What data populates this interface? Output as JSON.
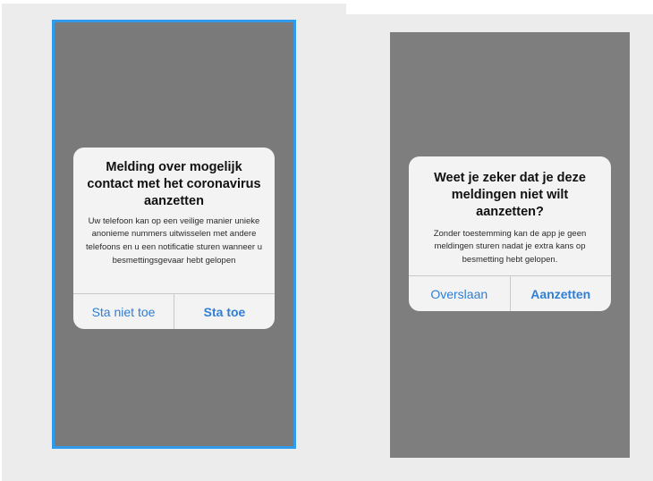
{
  "screens": [
    {
      "dialog": {
        "title": "Melding over mogelijk contact met het coronavirus aanzetten",
        "message": "Uw telefoon kan op een veilige manier unieke anonieme nummers uitwisselen met andere telefoons en u een notificatie sturen wanneer u besmettingsgevaar hebt gelopen",
        "buttons": [
          {
            "label": "Sta niet toe",
            "style": "normal"
          },
          {
            "label": "Sta toe",
            "style": "bold"
          }
        ]
      }
    },
    {
      "dialog": {
        "title": "Weet je zeker dat je deze meldingen niet wilt aanzetten?",
        "message": "Zonder toestemming kan de app je geen meldingen sturen nadat je extra kans op besmetting hebt gelopen.",
        "buttons": [
          {
            "label": "Overslaan",
            "style": "normal"
          },
          {
            "label": "Aanzetten",
            "style": "bold"
          }
        ]
      }
    }
  ],
  "colors": {
    "accent": "#2f7fd6",
    "selection_border": "#2f9bea",
    "screen_overlay": "#7d7d7d",
    "dialog_background": "#f3f3f3"
  }
}
